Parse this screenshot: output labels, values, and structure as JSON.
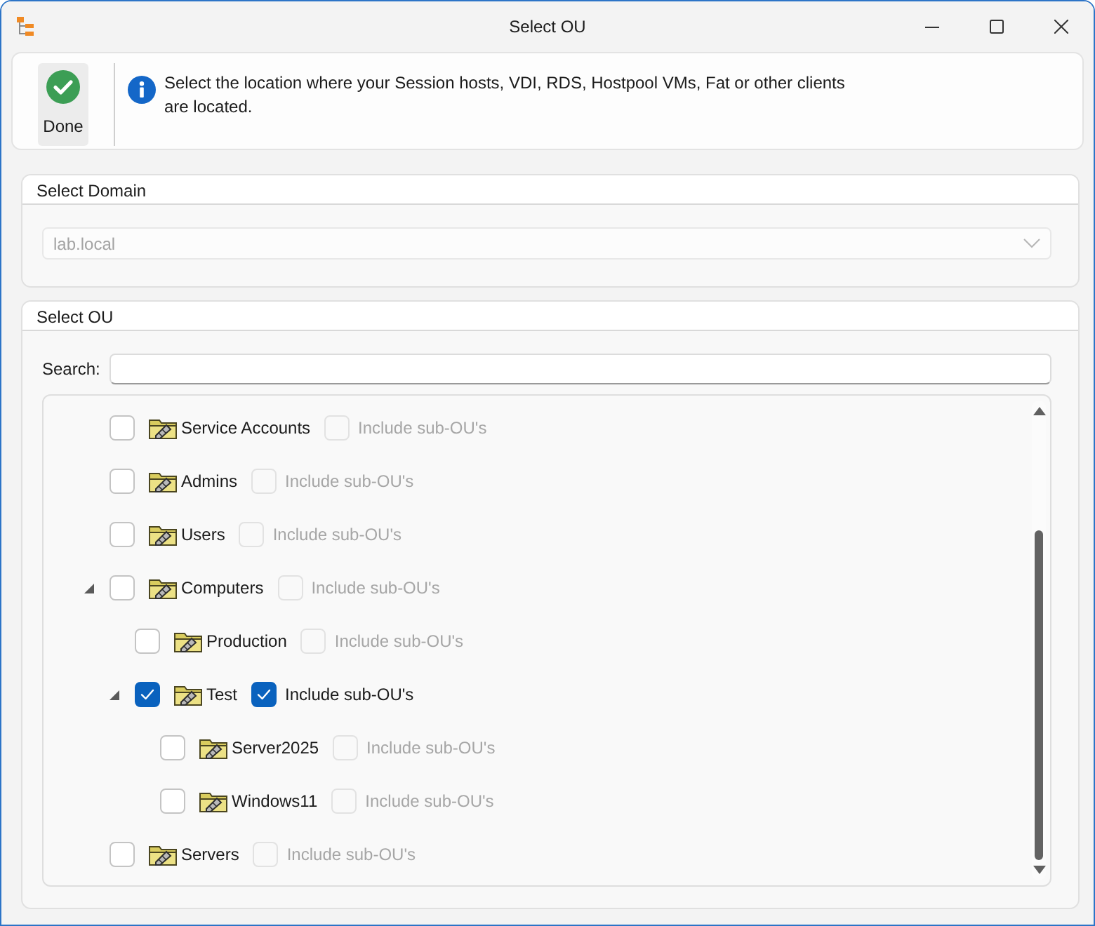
{
  "window": {
    "title": "Select OU"
  },
  "toolbar": {
    "done_button": {
      "label": "Done"
    },
    "info": "Select the location where your Session hosts, VDI, RDS, Hostpool VMs, Fat or other clients are located."
  },
  "domain_group": {
    "title": "Select Domain",
    "domain": {
      "value": "lab.local",
      "disabled": true
    }
  },
  "ou_group": {
    "title": "Select OU",
    "search": {
      "label": "Search:"
    },
    "ou_tree": [
      {
        "name": "Service Accounts",
        "checked": false,
        "include_sub": {
          "label": "Include sub-OU's",
          "checked": false,
          "disabled": true
        }
      },
      {
        "name": "Admins",
        "checked": false,
        "include_sub": {
          "label": "Include sub-OU's",
          "checked": false,
          "disabled": true
        }
      },
      {
        "name": "Users",
        "checked": false,
        "include_sub": {
          "label": "Include sub-OU's",
          "checked": false,
          "disabled": true
        }
      },
      {
        "name": "Computers",
        "expanded": true,
        "checked": false,
        "include_sub": {
          "label": "Include sub-OU's",
          "checked": false,
          "disabled": true
        },
        "children": [
          {
            "name": "Production",
            "checked": false,
            "include_sub": {
              "label": "Include sub-OU's",
              "checked": false,
              "disabled": true
            }
          },
          {
            "name": "Test",
            "expanded": true,
            "checked": true,
            "include_sub": {
              "label": "Include sub-OU's",
              "checked": true,
              "disabled": false
            },
            "children": [
              {
                "name": "Server2025",
                "checked": false,
                "include_sub": {
                  "label": "Include sub-OU's",
                  "checked": false,
                  "disabled": true
                }
              },
              {
                "name": "Windows11",
                "checked": false,
                "include_sub": {
                  "label": "Include sub-OU's",
                  "checked": false,
                  "disabled": true
                }
              }
            ]
          }
        ]
      },
      {
        "name": "Servers",
        "checked": false,
        "include_sub": {
          "label": "Include sub-OU's",
          "checked": false,
          "disabled": true
        }
      }
    ]
  }
}
